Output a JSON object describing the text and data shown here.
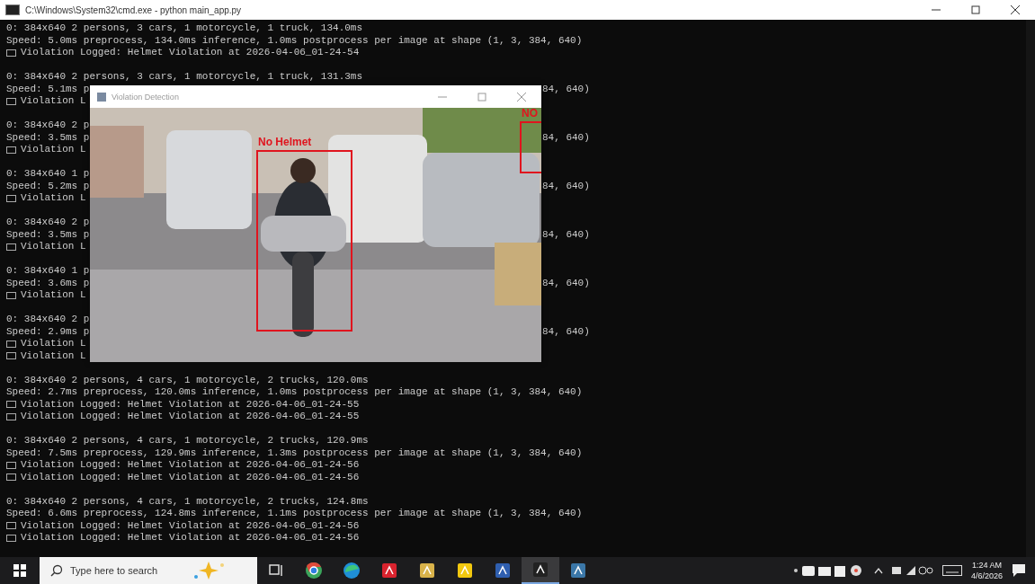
{
  "console_window": {
    "title": "C:\\Windows\\System32\\cmd.exe - python  main_app.py",
    "lines": [
      {
        "kind": "text",
        "text": "0: 384x640 2 persons, 3 cars, 1 motorcycle, 1 truck, 134.0ms"
      },
      {
        "kind": "text",
        "text": "Speed: 5.0ms preprocess, 134.0ms inference, 1.0ms postprocess per image at shape (1, 3, 384, 640)"
      },
      {
        "kind": "log",
        "text": "Violation Logged: Helmet Violation at 2026-04-06_01-24-54"
      },
      {
        "kind": "blank"
      },
      {
        "kind": "text",
        "text": "0: 384x640 2 persons, 3 cars, 1 motorcycle, 1 truck, 131.3ms"
      },
      {
        "kind": "text",
        "text": "Speed: 5.1ms p",
        "tail": "84, 640)"
      },
      {
        "kind": "log",
        "text": "Violation L"
      },
      {
        "kind": "blank"
      },
      {
        "kind": "text",
        "text": "0: 384x640 2 p"
      },
      {
        "kind": "text",
        "text": "Speed: 3.5ms p",
        "tail": "84, 640)"
      },
      {
        "kind": "log",
        "text": "Violation L"
      },
      {
        "kind": "blank"
      },
      {
        "kind": "text",
        "text": "0: 384x640 1 p"
      },
      {
        "kind": "text",
        "text": "Speed: 5.2ms p",
        "tail": "84, 640)"
      },
      {
        "kind": "log",
        "text": "Violation L"
      },
      {
        "kind": "blank"
      },
      {
        "kind": "text",
        "text": "0: 384x640 2 p"
      },
      {
        "kind": "text",
        "text": "Speed: 3.5ms p",
        "tail": "84, 640)"
      },
      {
        "kind": "log",
        "text": "Violation L"
      },
      {
        "kind": "blank"
      },
      {
        "kind": "text",
        "text": "0: 384x640 1 p"
      },
      {
        "kind": "text",
        "text": "Speed: 3.6ms p",
        "tail": "84, 640)"
      },
      {
        "kind": "log",
        "text": "Violation L"
      },
      {
        "kind": "blank"
      },
      {
        "kind": "text",
        "text": "0: 384x640 2 p"
      },
      {
        "kind": "text",
        "text": "Speed: 2.9ms p",
        "tail": "84, 640)"
      },
      {
        "kind": "log",
        "text": "Violation L"
      },
      {
        "kind": "log",
        "text": "Violation L"
      },
      {
        "kind": "blank"
      },
      {
        "kind": "text",
        "text": "0: 384x640 2 persons, 4 cars, 1 motorcycle, 2 trucks, 120.0ms"
      },
      {
        "kind": "text",
        "text": "Speed: 2.7ms preprocess, 120.0ms inference, 1.0ms postprocess per image at shape (1, 3, 384, 640)"
      },
      {
        "kind": "log",
        "text": "Violation Logged: Helmet Violation at 2026-04-06_01-24-55"
      },
      {
        "kind": "log",
        "text": "Violation Logged: Helmet Violation at 2026-04-06_01-24-55"
      },
      {
        "kind": "blank"
      },
      {
        "kind": "text",
        "text": "0: 384x640 2 persons, 4 cars, 1 motorcycle, 2 trucks, 120.9ms"
      },
      {
        "kind": "text",
        "text": "Speed: 7.5ms preprocess, 129.9ms inference, 1.3ms postprocess per image at shape (1, 3, 384, 640)"
      },
      {
        "kind": "log",
        "text": "Violation Logged: Helmet Violation at 2026-04-06_01-24-56"
      },
      {
        "kind": "log",
        "text": "Violation Logged: Helmet Violation at 2026-04-06_01-24-56"
      },
      {
        "kind": "blank"
      },
      {
        "kind": "text",
        "text": "0: 384x640 2 persons, 4 cars, 1 motorcycle, 2 trucks, 124.8ms"
      },
      {
        "kind": "text",
        "text": "Speed: 6.6ms preprocess, 124.8ms inference, 1.1ms postprocess per image at shape (1, 3, 384, 640)"
      },
      {
        "kind": "log",
        "text": "Violation Logged: Helmet Violation at 2026-04-06_01-24-56"
      },
      {
        "kind": "log",
        "text": "Violation Logged: Helmet Violation at 2026-04-06_01-24-56"
      }
    ]
  },
  "detection_window": {
    "title": "Violation Detection",
    "detections": [
      {
        "label": "No Helmet"
      },
      {
        "label": "NO"
      }
    ]
  },
  "taskbar": {
    "search": {
      "placeholder": "Type here to search"
    },
    "apps": [
      {
        "kind": "taskview",
        "active": false
      },
      {
        "kind": "chrome",
        "active": false
      },
      {
        "kind": "edge",
        "active": false
      },
      {
        "kind": "wps",
        "active": false
      },
      {
        "kind": "files",
        "active": false
      },
      {
        "kind": "notes",
        "active": false
      },
      {
        "kind": "letter",
        "active": false
      },
      {
        "kind": "terminal",
        "active": true
      },
      {
        "kind": "python",
        "active": false
      }
    ],
    "time": "1:24 AM",
    "date": "4/6/2026"
  }
}
